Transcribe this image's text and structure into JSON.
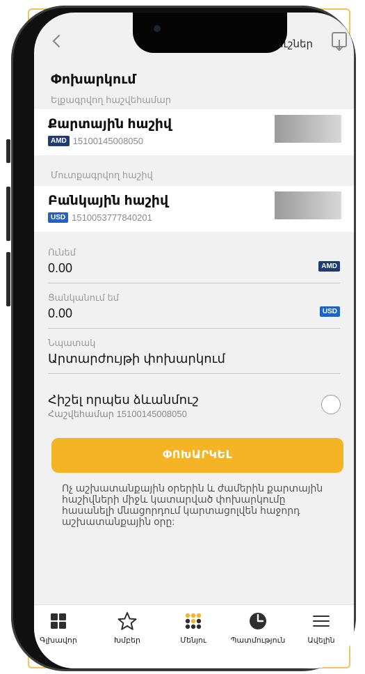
{
  "topbar": {
    "right_text": "նմուշներ",
    "back_icon": "chevron-left-icon",
    "doc_icon": "document-download-icon"
  },
  "page_title": "Փոխարկում",
  "from_section": {
    "label": "Ելքագրվող հաշվեհամար",
    "account_name": "Քարտային հաշիվ",
    "currency": "AMD",
    "account_number": "15100145008050"
  },
  "to_section": {
    "label": "Մուտքագրվող հաշիվ",
    "account_name": "Բանկային հաշիվ",
    "currency": "USD",
    "account_number": "1510053777840201"
  },
  "have_field": {
    "label": "Ունեմ",
    "value": "0.00",
    "currency": "AMD"
  },
  "want_field": {
    "label": "Ցանկանում եմ",
    "value": "0.00",
    "currency": "USD"
  },
  "purpose_field": {
    "label": "Նպատակ",
    "value": "Արտարժույթի փոխարկում"
  },
  "save_template": {
    "title": "Հիշել որպես ձևանմուշ",
    "subtitle": "Հաշվեհամար 15100145008050"
  },
  "submit_button": "ՓՈԽԱՐԿԵԼ",
  "note": "Ոչ աշխատանքային օրերին և ժամերին քարտային հաշիվների միջև կատարված փոխարկումը հասանելի մնացորդում կարտացոլվեն հաջորդ աշխատանքային օրը:",
  "tabbar": [
    {
      "label": "Գլխավոր",
      "icon": "grid-icon"
    },
    {
      "label": "Խմբեր",
      "icon": "star-icon"
    },
    {
      "label": "Մենյու",
      "icon": "menu-dots-icon"
    },
    {
      "label": "Պատմություն",
      "icon": "clock-icon"
    },
    {
      "label": "Ավելին",
      "icon": "hamburger-icon"
    }
  ],
  "colors": {
    "accent": "#f5b326",
    "badge_amd": "#1c3c78",
    "badge_usd": "#1f63c6",
    "frame_accent": "#f4c15a"
  }
}
